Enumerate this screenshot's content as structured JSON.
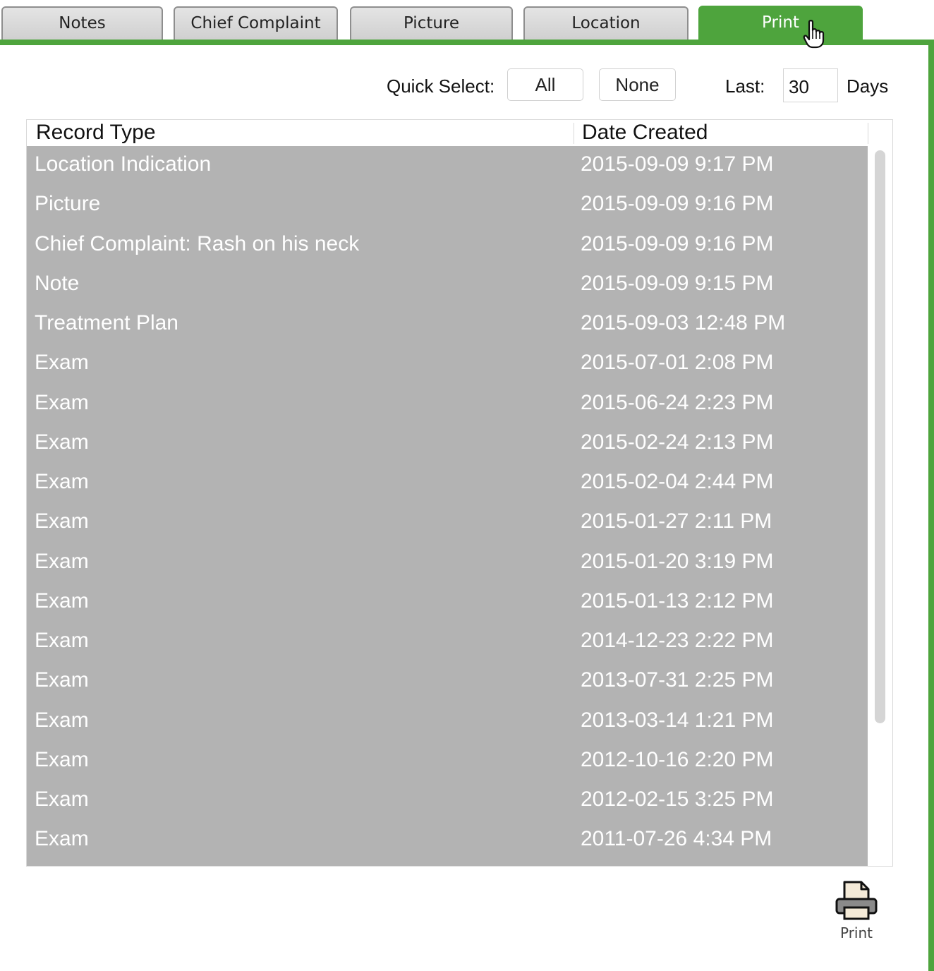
{
  "tabs": [
    {
      "label": "Notes",
      "active": false
    },
    {
      "label": "Chief Complaint",
      "active": false
    },
    {
      "label": "Picture",
      "active": false
    },
    {
      "label": "Location",
      "active": false
    },
    {
      "label": "Print",
      "active": true
    }
  ],
  "quick_select": {
    "label": "Quick Select:",
    "all_label": "All",
    "none_label": "None"
  },
  "last": {
    "label": "Last:",
    "value": "30",
    "unit": "Days"
  },
  "table": {
    "columns": [
      "Record Type",
      "Date Created"
    ],
    "rows": [
      {
        "type": "Location Indication",
        "date": "2015-09-09 9:17 PM"
      },
      {
        "type": "Picture",
        "date": "2015-09-09 9:16 PM"
      },
      {
        "type": "Chief Complaint: Rash on his neck",
        "date": "2015-09-09 9:16 PM"
      },
      {
        "type": "Note",
        "date": "2015-09-09 9:15 PM"
      },
      {
        "type": "Treatment Plan",
        "date": "2015-09-03 12:48 PM"
      },
      {
        "type": "Exam",
        "date": "2015-07-01 2:08 PM"
      },
      {
        "type": "Exam",
        "date": "2015-06-24 2:23 PM"
      },
      {
        "type": "Exam",
        "date": "2015-02-24 2:13 PM"
      },
      {
        "type": "Exam",
        "date": "2015-02-04 2:44 PM"
      },
      {
        "type": "Exam",
        "date": "2015-01-27 2:11 PM"
      },
      {
        "type": "Exam",
        "date": "2015-01-20 3:19 PM"
      },
      {
        "type": "Exam",
        "date": "2015-01-13 2:12 PM"
      },
      {
        "type": "Exam",
        "date": "2014-12-23 2:22 PM"
      },
      {
        "type": "Exam",
        "date": "2013-07-31 2:25 PM"
      },
      {
        "type": "Exam",
        "date": "2013-03-14 1:21 PM"
      },
      {
        "type": "Exam",
        "date": "2012-10-16 2:20 PM"
      },
      {
        "type": "Exam",
        "date": "2012-02-15 3:25 PM"
      },
      {
        "type": "Exam",
        "date": "2011-07-26 4:34 PM"
      }
    ],
    "selected_all": true
  },
  "print_button": {
    "label": "Print",
    "icon": "printer-icon"
  },
  "colors": {
    "accent": "#4ea43d",
    "selected_row": "#b3b3b3"
  }
}
